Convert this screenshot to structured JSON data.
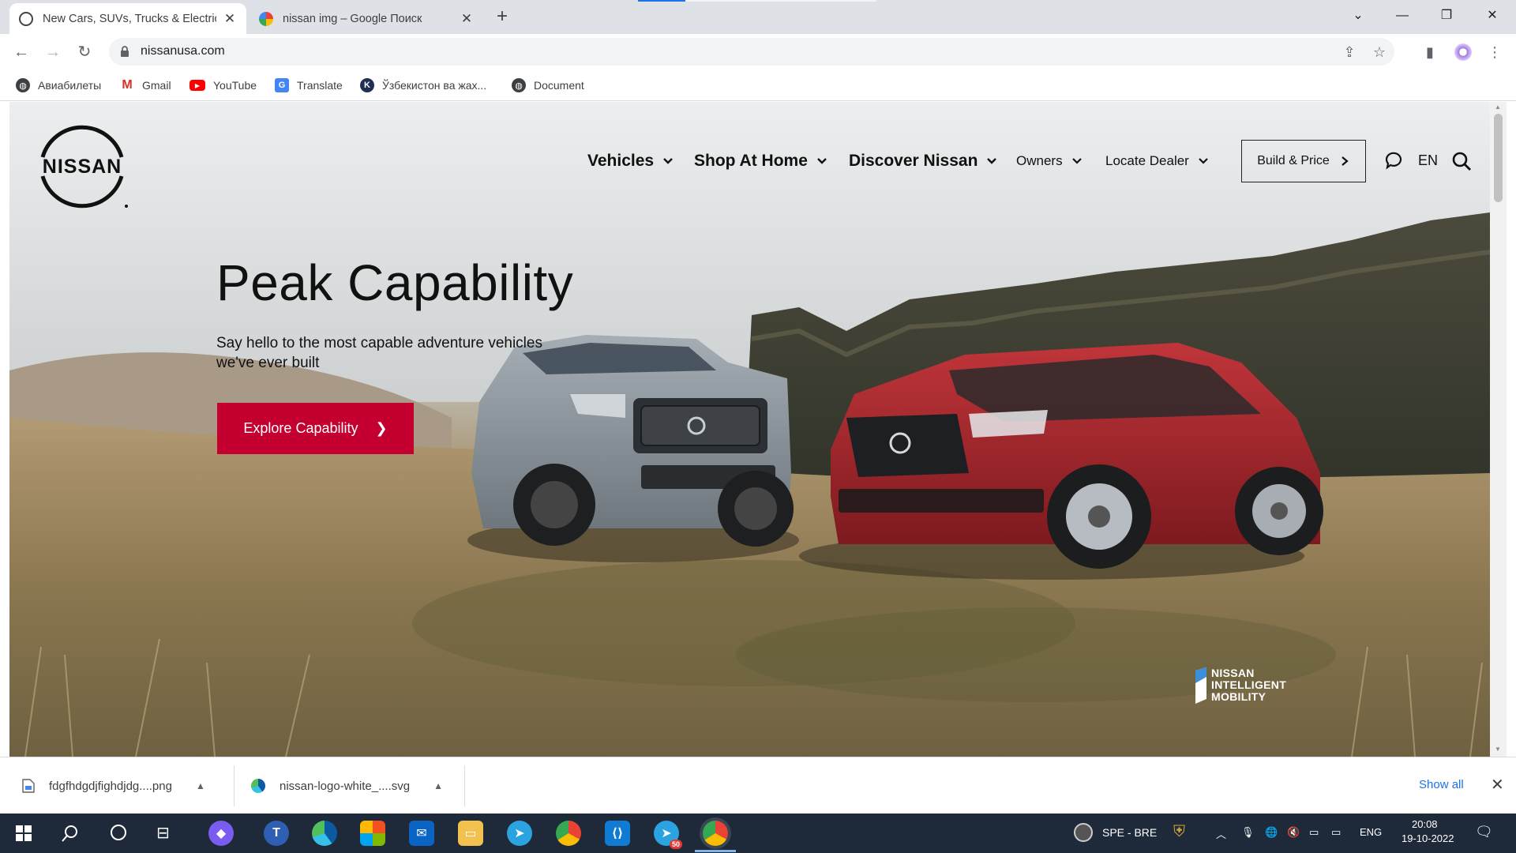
{
  "browser": {
    "tabs": [
      {
        "title": "New Cars, SUVs, Trucks & Electric",
        "active": true
      },
      {
        "title": "nissan img – Google Поиск",
        "active": false
      }
    ],
    "new_tab": "+",
    "url": "nissanusa.com",
    "bookmarks": [
      {
        "label": "Авиабилеты",
        "icon": "globe-icon"
      },
      {
        "label": "Gmail",
        "icon": "gmail-icon"
      },
      {
        "label": "YouTube",
        "icon": "youtube-icon"
      },
      {
        "label": "Translate",
        "icon": "translate-icon"
      },
      {
        "label": "Ўзбекистон ва жах...",
        "icon": "k-icon"
      },
      {
        "label": "Document",
        "icon": "globe-icon"
      }
    ]
  },
  "site": {
    "logo_text": "NISSAN",
    "nav": [
      {
        "label": "Vehicles"
      },
      {
        "label": "Shop At Home"
      },
      {
        "label": "Discover Nissan"
      },
      {
        "label": "Owners"
      },
      {
        "label": "Locate Dealer"
      }
    ],
    "build_price": "Build & Price",
    "language": "EN",
    "hero": {
      "title": "Peak Capability",
      "subtitle": "Say hello to the most capable adventure vehicles we've ever built",
      "cta": "Explore Capability"
    },
    "badge": [
      "NISSAN",
      "INTELLIGENT",
      "MOBILITY"
    ],
    "colors": {
      "brand_red": "#c3002f",
      "truck": "#8a939c",
      "suv": "#a8232a"
    }
  },
  "downloads": {
    "items": [
      {
        "name": "fdgfhdgdjfighdjdg....png",
        "icon": "image-file-icon"
      },
      {
        "name": "nissan-logo-white_....svg",
        "icon": "edge-icon"
      }
    ],
    "show_all": "Show all"
  },
  "taskbar": {
    "tray_text": "SPE - BRE",
    "lang": "ENG",
    "time": "20:08",
    "date": "19-10-2022",
    "telegram_badge": "50"
  }
}
